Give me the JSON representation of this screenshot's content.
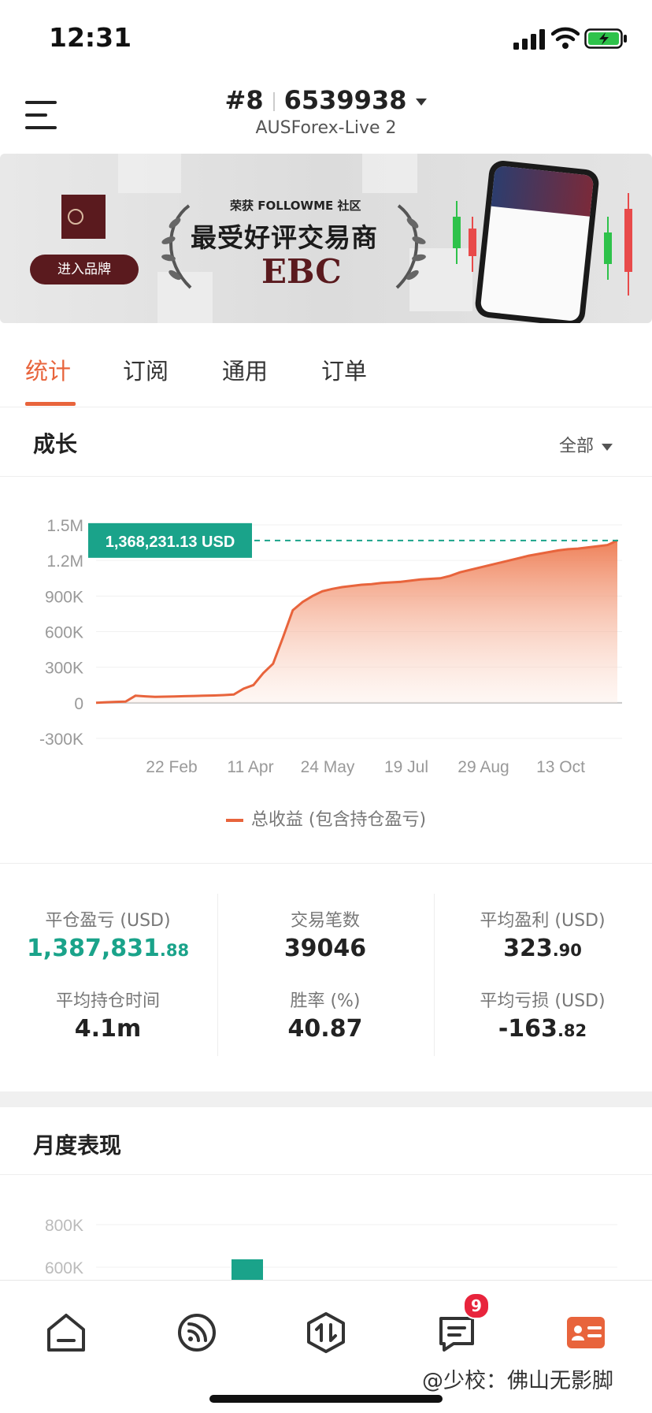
{
  "status_bar": {
    "time": "12:31"
  },
  "header": {
    "rank": "#8",
    "account_number": "6539938",
    "server": "AUSForex-Live 2"
  },
  "banner": {
    "button_label": "进入品牌",
    "line1": "荣获 FOLLOWME 社区",
    "line2": "最受好评交易商",
    "line3": "EBC"
  },
  "tabs": [
    {
      "label": "统计",
      "active": true
    },
    {
      "label": "订阅",
      "active": false
    },
    {
      "label": "通用",
      "active": false
    },
    {
      "label": "订单",
      "active": false
    }
  ],
  "growth": {
    "title": "成长",
    "range_label": "全部"
  },
  "chart_data": {
    "type": "area",
    "y_ticks": [
      "1.5M",
      "1.2M",
      "900K",
      "600K",
      "300K",
      "0",
      "-300K"
    ],
    "x_ticks": [
      "22 Feb",
      "11 Apr",
      "24 May",
      "19 Jul",
      "29 Aug",
      "13 Oct"
    ],
    "ylim": [
      -300000,
      1500000
    ],
    "current_value_label": "1,368,231.13 USD",
    "current_value": 1368231.13,
    "series": [
      {
        "name": "总收益 (包含持仓盈亏)",
        "color": "#e8643c",
        "values": [
          0,
          5000,
          8000,
          10000,
          60000,
          55000,
          50000,
          52000,
          54000,
          56000,
          58000,
          60000,
          62000,
          65000,
          70000,
          120000,
          150000,
          250000,
          330000,
          550000,
          780000,
          850000,
          900000,
          940000,
          960000,
          975000,
          985000,
          995000,
          1000000,
          1010000,
          1015000,
          1020000,
          1030000,
          1040000,
          1045000,
          1050000,
          1070000,
          1100000,
          1120000,
          1140000,
          1160000,
          1180000,
          1200000,
          1220000,
          1240000,
          1255000,
          1270000,
          1285000,
          1295000,
          1300000,
          1310000,
          1320000,
          1330000,
          1368231
        ]
      }
    ],
    "grid": true
  },
  "stats": [
    {
      "label": "平仓盈亏 (USD)",
      "int": "1,387,831",
      "dec": ".88",
      "green": true
    },
    {
      "label": "交易笔数",
      "int": "39046",
      "dec": "",
      "green": false
    },
    {
      "label": "平均盈利 (USD)",
      "int": "323",
      "dec": ".90",
      "green": false
    },
    {
      "label": "平均持仓时间",
      "int": "4.1m",
      "dec": "",
      "green": false
    },
    {
      "label": "胜率 (%)",
      "int": "40.87",
      "dec": "",
      "green": false
    },
    {
      "label": "平均亏损 (USD)",
      "int": "-163",
      "dec": ".82",
      "green": false
    }
  ],
  "monthly": {
    "title": "月度表现",
    "y_ticks": [
      "800K",
      "600K"
    ],
    "ylim_visible": [
      550000,
      850000
    ],
    "bar_color": "#1aa38a"
  },
  "bottom_nav": {
    "items": [
      {
        "icon": "home-icon"
      },
      {
        "icon": "feed-icon"
      },
      {
        "icon": "trade-icon"
      },
      {
        "icon": "message-icon",
        "badge": "9"
      },
      {
        "icon": "profile-card-icon",
        "active": true
      }
    ],
    "accent_color": "#e8643c"
  },
  "watermark": "@少校：佛山无影脚"
}
